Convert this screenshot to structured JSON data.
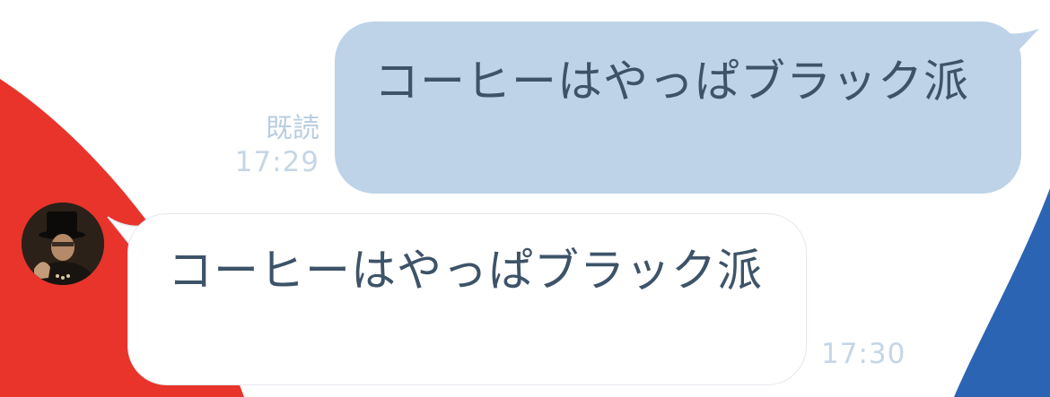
{
  "colors": {
    "background": "#ffffff",
    "accent_red": "#e8342a",
    "accent_blue": "#2c64b4",
    "sent_bubble": "#bed3e8",
    "received_bubble": "#ffffff",
    "message_text": "#3d5368",
    "meta_text": "#c5d6e6"
  },
  "messages": [
    {
      "direction": "sent",
      "text": "コーヒーはやっぱブラック派",
      "read_label": "既読",
      "time": "17:29"
    },
    {
      "direction": "received",
      "text": "コーヒーはやっぱブラック派",
      "time": "17:30",
      "avatar_icon": "user-avatar-icon"
    }
  ]
}
